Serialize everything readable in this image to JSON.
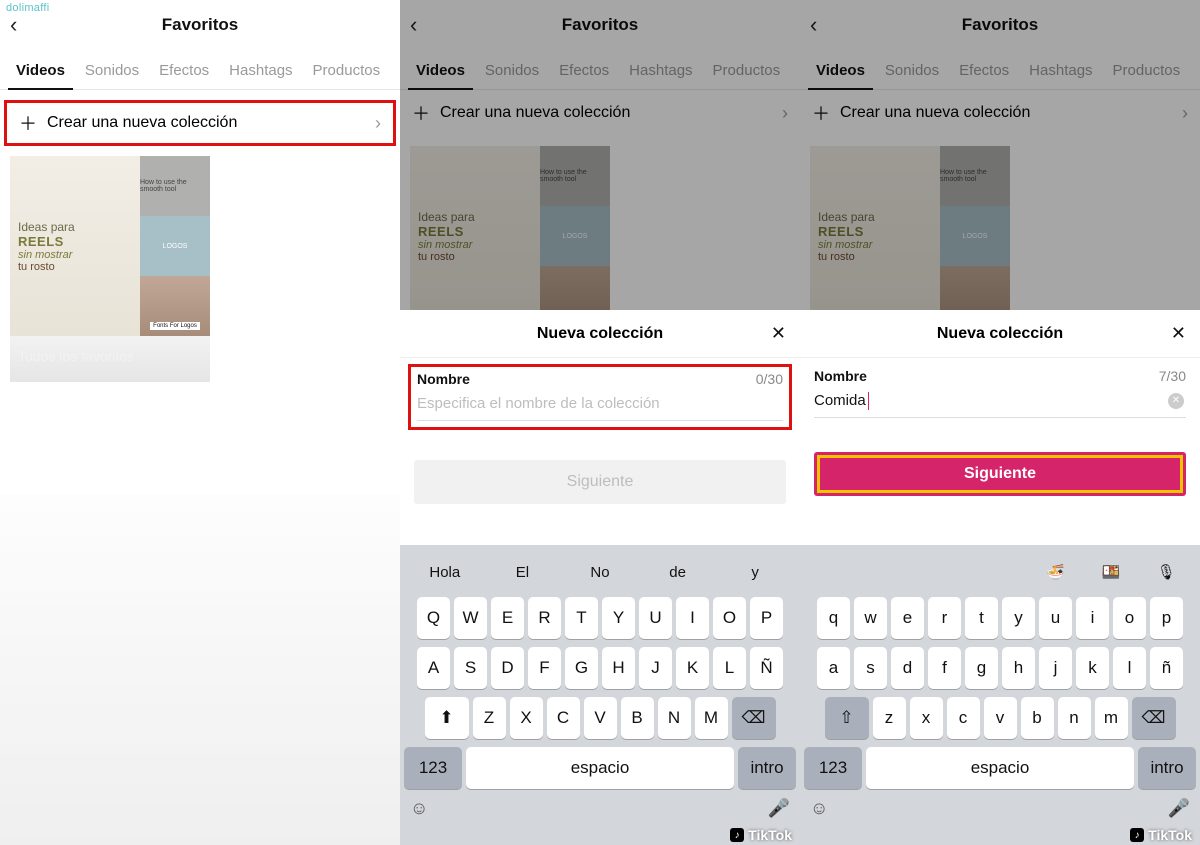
{
  "username": "dolimaffi",
  "header_title": "Favoritos",
  "tabs": [
    "Videos",
    "Sonidos",
    "Efectos",
    "Hashtags",
    "Productos"
  ],
  "create_collection_label": "Crear una nueva colección",
  "collection_card_label": "Todos los favoritos",
  "thumb_big": {
    "l1": "Ideas para",
    "l2": "REELS",
    "l3": "sin mostrar",
    "l4": "tu rosto"
  },
  "thumb_small1": "How to use the smooth tool",
  "thumb_small2": "LOGOS",
  "thumb_small3_tag": "Fonts For Logos",
  "modal_title": "Nueva colección",
  "field_label": "Nombre",
  "placeholder_text": "Especifica el nombre de la colección",
  "typed_text": "Comida",
  "counter_empty": "0/30",
  "counter_filled": "7/30",
  "next_label": "Siguiente",
  "suggestions": {
    "upper": [
      "Hola",
      "El",
      "No",
      "de",
      "y"
    ],
    "lower": []
  },
  "icons_suggestion": [
    "🍜",
    "🍱",
    "🎙"
  ],
  "kb_rows_upper": [
    [
      "Q",
      "W",
      "E",
      "R",
      "T",
      "Y",
      "U",
      "I",
      "O",
      "P"
    ],
    [
      "A",
      "S",
      "D",
      "F",
      "G",
      "H",
      "J",
      "K",
      "L",
      "Ñ"
    ],
    [
      "Z",
      "X",
      "C",
      "V",
      "B",
      "N",
      "M"
    ]
  ],
  "kb_rows_lower": [
    [
      "q",
      "w",
      "e",
      "r",
      "t",
      "y",
      "u",
      "i",
      "o",
      "p"
    ],
    [
      "a",
      "s",
      "d",
      "f",
      "g",
      "h",
      "j",
      "k",
      "l",
      "ñ"
    ],
    [
      "z",
      "x",
      "c",
      "v",
      "b",
      "n",
      "m"
    ]
  ],
  "kb_123": "123",
  "kb_space": "espacio",
  "kb_intro": "intro",
  "tiktok_wm": "TikTok"
}
